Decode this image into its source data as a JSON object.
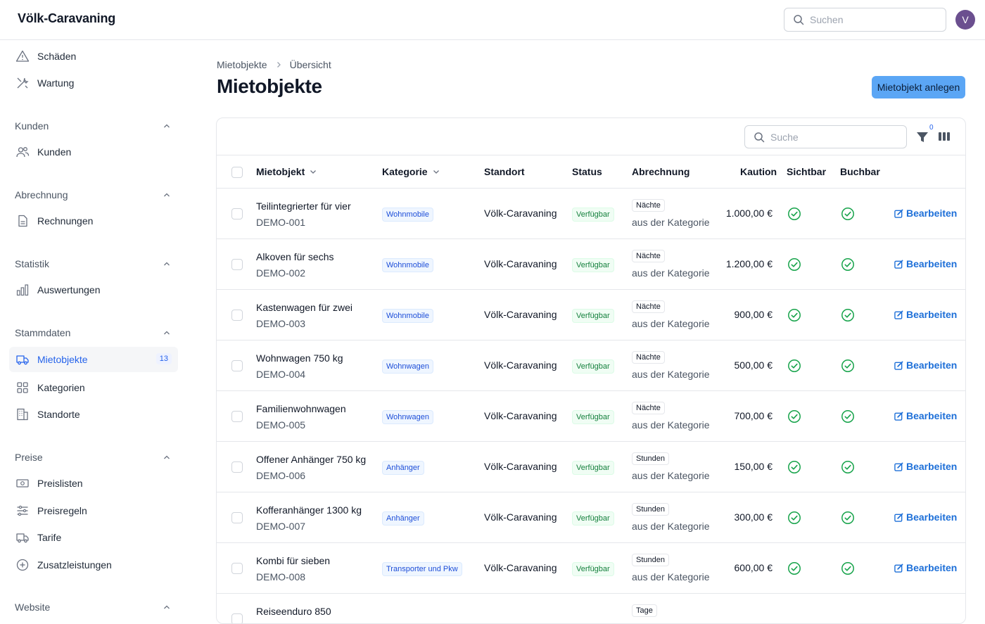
{
  "app": {
    "brand": "Völk-Caravaning",
    "search_placeholder": "Suchen",
    "avatar_initial": "V"
  },
  "sidebar": {
    "items_top": [
      {
        "label": "Schäden",
        "icon": "warning-triangle-icon"
      },
      {
        "label": "Wartung",
        "icon": "wrench-screwdriver-icon"
      }
    ],
    "sections": [
      {
        "title": "Kunden",
        "items": [
          {
            "label": "Kunden",
            "icon": "users-icon"
          }
        ]
      },
      {
        "title": "Abrechnung",
        "items": [
          {
            "label": "Rechnungen",
            "icon": "document-icon"
          }
        ]
      },
      {
        "title": "Statistik",
        "items": [
          {
            "label": "Auswertungen",
            "icon": "bar-chart-icon"
          }
        ]
      },
      {
        "title": "Stammdaten",
        "items": [
          {
            "label": "Mietobjekte",
            "icon": "truck-icon",
            "badge": "13",
            "active": true
          },
          {
            "label": "Kategorien",
            "icon": "grid-icon"
          },
          {
            "label": "Standorte",
            "icon": "building-icon"
          }
        ]
      },
      {
        "title": "Preise",
        "items": [
          {
            "label": "Preislisten",
            "icon": "banknote-icon"
          },
          {
            "label": "Preisregeln",
            "icon": "sliders-icon"
          },
          {
            "label": "Tarife",
            "icon": "truck-small-icon"
          },
          {
            "label": "Zusatzleistungen",
            "icon": "plus-circle-icon"
          }
        ]
      },
      {
        "title": "Website",
        "items": []
      }
    ]
  },
  "main": {
    "breadcrumb": [
      "Mietobjekte",
      "Übersicht"
    ],
    "title": "Mietobjekte",
    "primary_action": "Mietobjekt anlegen",
    "table_search_placeholder": "Suche",
    "filter_count": "0",
    "columns": {
      "mietobjekt": "Mietobjekt",
      "kategorie": "Kategorie",
      "standort": "Standort",
      "status": "Status",
      "abrechnung": "Abrechnung",
      "kaution": "Kaution",
      "sichtbar": "Sichtbar",
      "buchbar": "Buchbar"
    },
    "edit_label": "Bearbeiten",
    "rows": [
      {
        "name": "Teilintegrierter für vier",
        "code": "DEMO-001",
        "category": "Wohnmobile",
        "location": "Völk-Caravaning",
        "status": "Verfügbar",
        "billing": "Nächte",
        "billing_sub": "aus der Kategorie",
        "deposit": "1.000,00 €"
      },
      {
        "name": "Alkoven für sechs",
        "code": "DEMO-002",
        "category": "Wohnmobile",
        "location": "Völk-Caravaning",
        "status": "Verfügbar",
        "billing": "Nächte",
        "billing_sub": "aus der Kategorie",
        "deposit": "1.200,00 €"
      },
      {
        "name": "Kastenwagen für zwei",
        "code": "DEMO-003",
        "category": "Wohnmobile",
        "location": "Völk-Caravaning",
        "status": "Verfügbar",
        "billing": "Nächte",
        "billing_sub": "aus der Kategorie",
        "deposit": "900,00 €"
      },
      {
        "name": "Wohnwagen 750 kg",
        "code": "DEMO-004",
        "category": "Wohnwagen",
        "location": "Völk-Caravaning",
        "status": "Verfügbar",
        "billing": "Nächte",
        "billing_sub": "aus der Kategorie",
        "deposit": "500,00 €"
      },
      {
        "name": "Familienwohnwagen",
        "code": "DEMO-005",
        "category": "Wohnwagen",
        "location": "Völk-Caravaning",
        "status": "Verfügbar",
        "billing": "Nächte",
        "billing_sub": "aus der Kategorie",
        "deposit": "700,00 €"
      },
      {
        "name": "Offener Anhänger 750 kg",
        "code": "DEMO-006",
        "category": "Anhänger",
        "location": "Völk-Caravaning",
        "status": "Verfügbar",
        "billing": "Stunden",
        "billing_sub": "aus der Kategorie",
        "deposit": "150,00 €"
      },
      {
        "name": "Kofferanhänger 1300 kg",
        "code": "DEMO-007",
        "category": "Anhänger",
        "location": "Völk-Caravaning",
        "status": "Verfügbar",
        "billing": "Stunden",
        "billing_sub": "aus der Kategorie",
        "deposit": "300,00 €"
      },
      {
        "name": "Kombi für sieben",
        "code": "DEMO-008",
        "category": "Transporter und Pkw",
        "location": "Völk-Caravaning",
        "status": "Verfügbar",
        "billing": "Stunden",
        "billing_sub": "aus der Kategorie",
        "deposit": "600,00 €"
      },
      {
        "name": "Reiseenduro 850",
        "code": "",
        "category": "",
        "location": "",
        "status": "",
        "billing": "Tage",
        "billing_sub": "",
        "deposit": ""
      }
    ]
  }
}
